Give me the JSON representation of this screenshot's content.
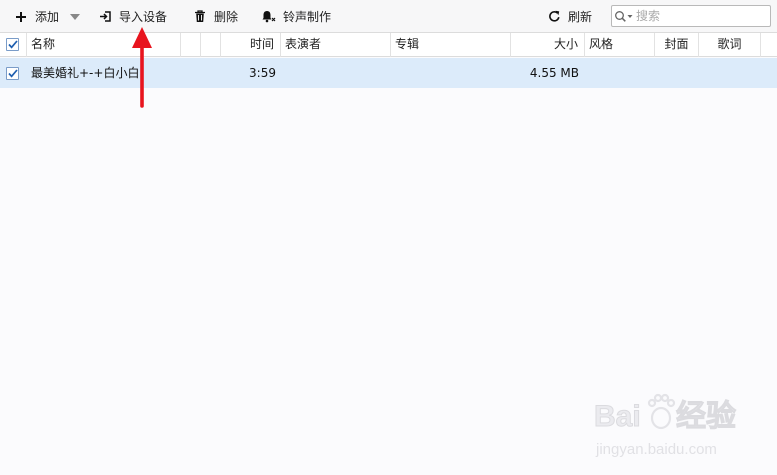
{
  "toolbar": {
    "add_label": "添加",
    "import_label": "导入设备",
    "delete_label": "删除",
    "ringtone_label": "铃声制作",
    "refresh_label": "刷新",
    "search_placeholder": "搜索"
  },
  "table": {
    "columns": [
      "名称",
      "时间",
      "表演者",
      "专辑",
      "大小",
      "风格",
      "封面",
      "歌词"
    ],
    "rows": [
      {
        "checked": true,
        "name": "最美婚礼+-+白小白",
        "time": "3:59",
        "artist": "",
        "album": "",
        "size": "4.55 MB",
        "genre": "",
        "cover": "",
        "lyrics": ""
      }
    ]
  },
  "annotation": {
    "color": "#e8141e"
  },
  "watermark": {
    "brand": "Bai du 经验",
    "url": "jingyan.baidu.com"
  }
}
